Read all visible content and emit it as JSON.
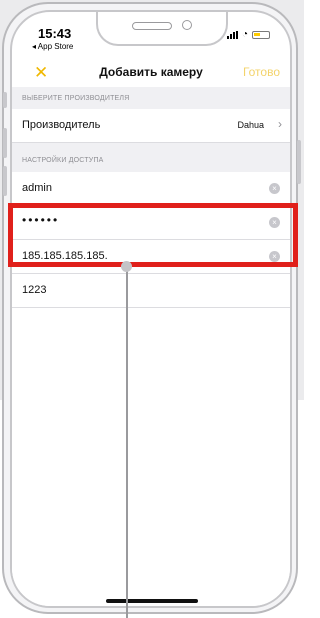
{
  "status_bar": {
    "time": "15:43",
    "back_label": "◂ App Store"
  },
  "nav": {
    "close_glyph": "✕",
    "title": "Добавить камеру",
    "done_label": "Готово"
  },
  "manufacturer_section": {
    "header": "ВЫБЕРИТЕ ПРОИЗВОДИТЕЛЯ",
    "row_label": "Производитель",
    "row_value": "Dahua",
    "chevron": "›"
  },
  "access_section": {
    "header": "НАСТРОЙКИ ДОСТУПА",
    "username": "admin",
    "password_mask": "••••••",
    "ip_address": "185.185.185.185.",
    "port": "1223",
    "clear_glyph": "×"
  },
  "colors": {
    "accent": "#f0b800",
    "done_disabled": "#f3d36b",
    "highlight": "#e0201b",
    "section_bg": "#f0f0f3"
  },
  "icons": [
    "close-icon",
    "chevron-right-icon",
    "clear-icon",
    "signal-icon",
    "wifi-icon",
    "battery-icon"
  ]
}
